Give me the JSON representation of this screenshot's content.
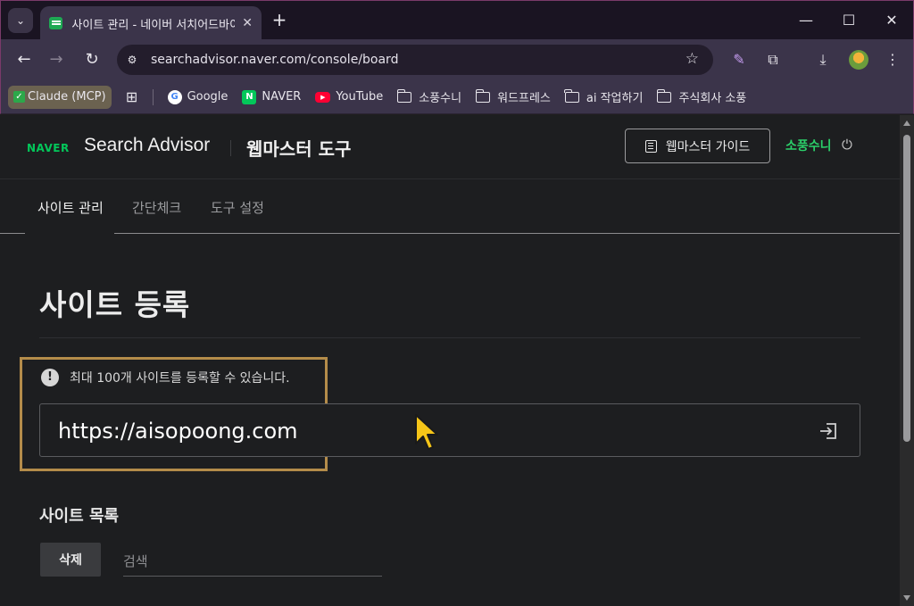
{
  "browser": {
    "tab_title": "사이트 관리 - 네이버 서치어드바이저",
    "new_tab_symbol": "+",
    "url": "searchadvisor.naver.com/console/board",
    "window_controls": [
      "—",
      "☐",
      "✕"
    ],
    "bookmarks": [
      {
        "label": "Claude (MCP)",
        "icon": "check-icon"
      },
      {
        "label": "Google",
        "icon": "google-icon"
      },
      {
        "label": "NAVER",
        "icon": "naver-icon"
      },
      {
        "label": "YouTube",
        "icon": "youtube-icon"
      },
      {
        "label": "소풍수니",
        "icon": "folder-icon"
      },
      {
        "label": "워드프레스",
        "icon": "folder-icon"
      },
      {
        "label": "ai 작업하기",
        "icon": "folder-icon"
      },
      {
        "label": "주식회사 소풍",
        "icon": "folder-icon"
      }
    ]
  },
  "header": {
    "brand": "NAVER",
    "product": "Search Advisor",
    "section": "웹마스터 도구",
    "guide_button": "웹마스터 가이드",
    "user_name": "소풍수니"
  },
  "subnav": {
    "items": [
      "사이트 관리",
      "간단체크",
      "도구 설정"
    ],
    "active_index": 0
  },
  "main": {
    "title": "사이트 등록",
    "notice": "최대 100개 사이트를 등록할 수 있습니다.",
    "url_value": "https://aisopoong.com",
    "list_title": "사이트 목록",
    "delete_button": "삭제",
    "search_placeholder": "검색"
  },
  "colors": {
    "naver_green": "#03c75a",
    "highlight_border": "#b48c4a",
    "cursor": "#f5c518"
  }
}
